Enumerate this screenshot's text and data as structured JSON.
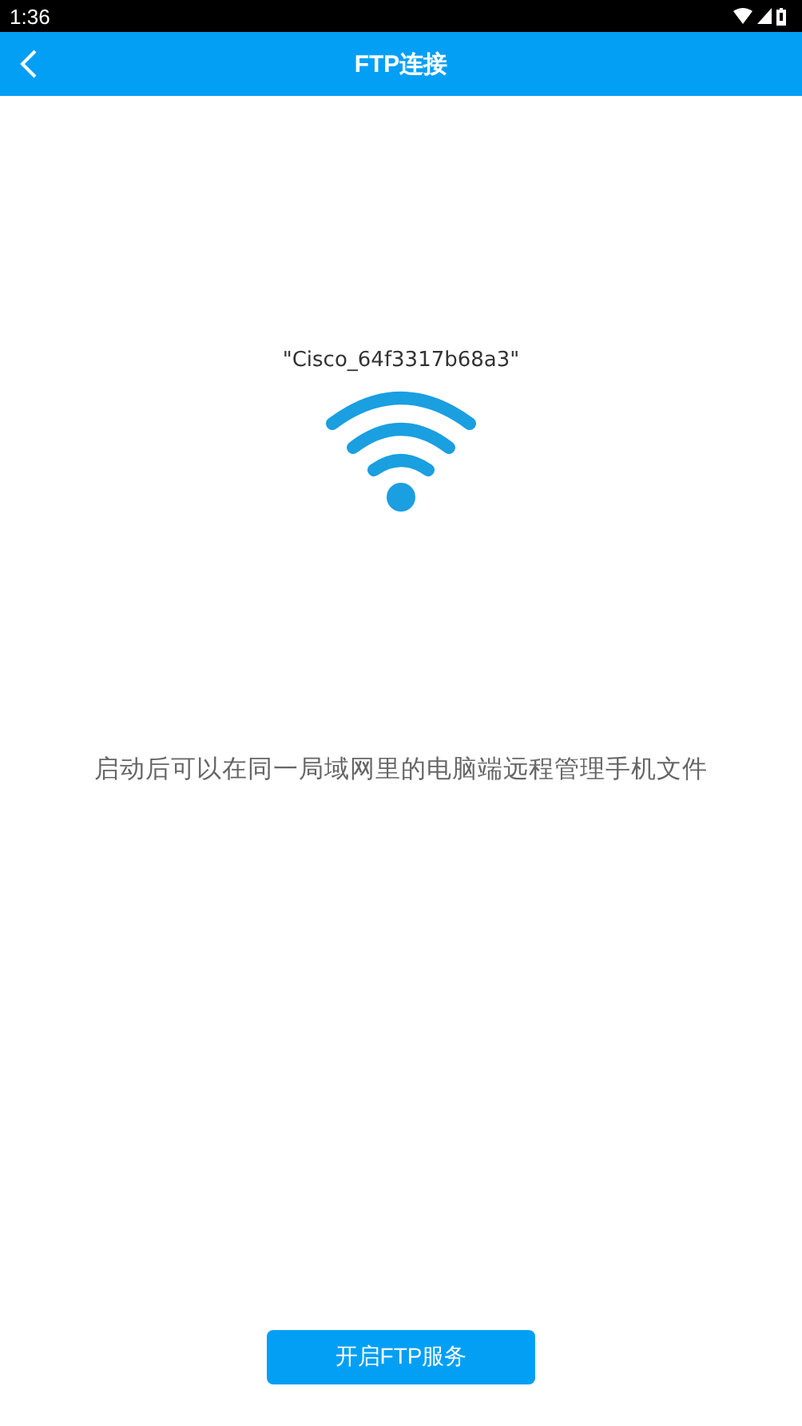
{
  "status_bar": {
    "time": "1:36"
  },
  "app_bar": {
    "title": "FTP连接"
  },
  "network": {
    "ssid": "\"Cisco_64f3317b68a3\""
  },
  "description": "启动后可以在同一局域网里的电脑端远程管理手机文件",
  "button": {
    "label": "开启FTP服务"
  }
}
